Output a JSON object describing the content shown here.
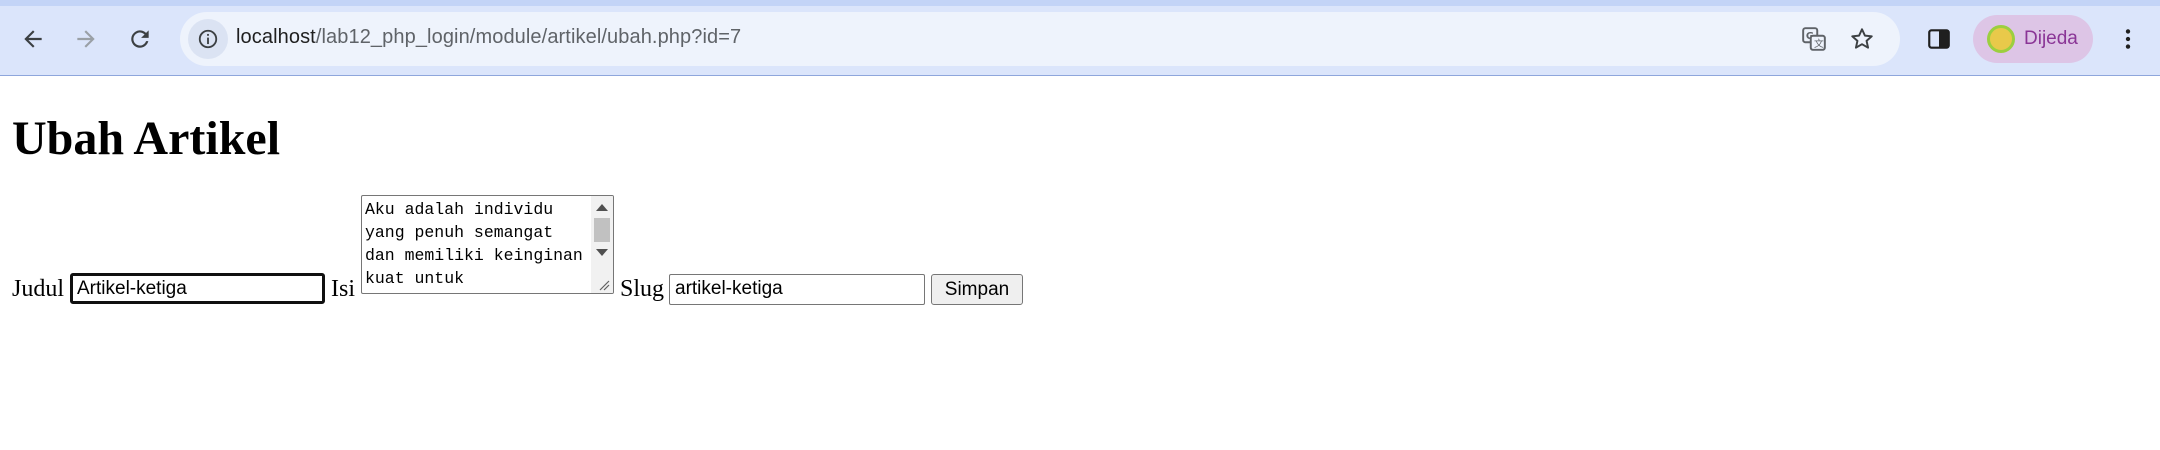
{
  "browser": {
    "url_host": "localhost",
    "url_path": "/lab12_php_login/module/artikel/ubah.php?id=7",
    "profile_name": "Dijeda",
    "icons": [
      "back-icon",
      "forward-icon",
      "reload-icon",
      "site-info-icon",
      "translate-icon",
      "bookmark-star-icon",
      "side-panel-icon",
      "avatar",
      "more-menu-icon"
    ]
  },
  "page": {
    "title": "Ubah Artikel",
    "form": {
      "judul_label": "Judul",
      "judul_value": "Artikel-ketiga",
      "isi_label": "Isi",
      "isi_value": "Aku adalah individu yang penuh semangat dan memiliki keinginan kuat untuk",
      "slug_label": "Slug",
      "slug_value": "artikel-ketiga",
      "submit_label": "Simpan"
    }
  },
  "colors": {
    "chrome_bg": "#dbe5fb",
    "omnibox_bg": "#eef3fc",
    "profile_chip_bg": "#ddc5e6",
    "profile_text": "#8a3596"
  }
}
